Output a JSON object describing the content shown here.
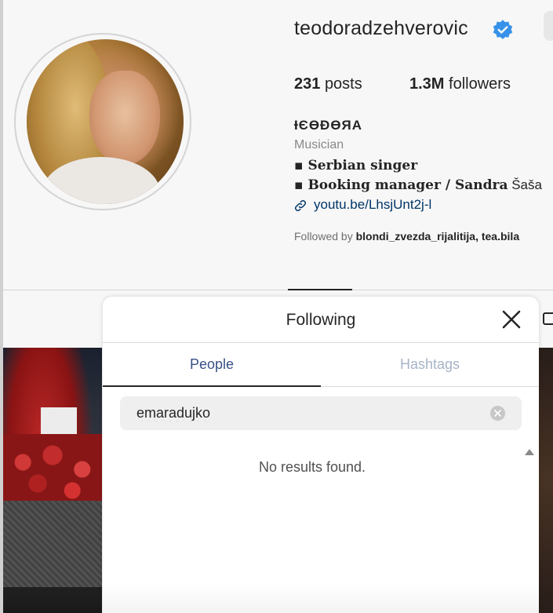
{
  "profile": {
    "username": "teodoradzehverovic",
    "verified_icon": "verified-badge-icon",
    "posts_count": "231",
    "posts_label": "posts",
    "followers_count": "1.3M",
    "followers_label": "followers",
    "full_name": "ƗЄӨĐӨЯA",
    "category": "Musician",
    "bio_line1": "▪ Serbian singer",
    "bio_line2_bold": "▪ Booking manager / Sandra",
    "bio_line2_plain": " Šaša",
    "link": "youtu.be/LhsjUnt2j-l",
    "followed_by_prefix": "Followed by ",
    "followed_by_users": "blondi_zvezda_rijalitija, tea.bila"
  },
  "modal": {
    "title": "Following",
    "tabs": [
      {
        "label": "People",
        "active": true
      },
      {
        "label": "Hashtags",
        "active": false
      }
    ],
    "search": {
      "value": "emaradujko"
    },
    "empty_message": "No results found.",
    "colors": {
      "active_tab": "#385185",
      "inactive_tab": "#a7b3c7",
      "verified": "#3897f0"
    }
  }
}
